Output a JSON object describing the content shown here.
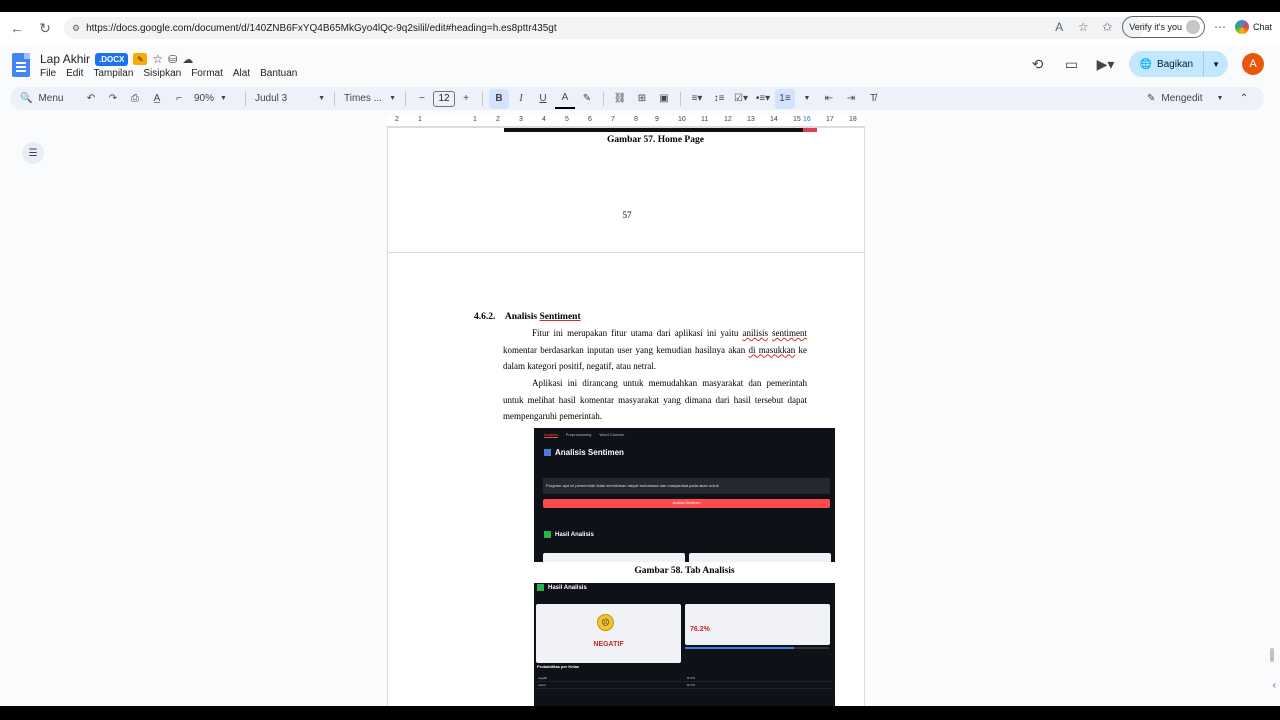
{
  "browser": {
    "url": "https://docs.google.com/document/d/140ZNB6FxYQ4B65MkGyo4lQc-9q2silil/edit#heading=h.es8pttr435gt",
    "verify_label": "Verify it's you",
    "chat_label": "Chat"
  },
  "doc": {
    "title": "Lap Akhir",
    "badge": ".DOCX",
    "menus": [
      "File",
      "Edit",
      "Tampilan",
      "Sisipkan",
      "Format",
      "Alat",
      "Bantuan"
    ],
    "share_label": "Bagikan",
    "avatar_letter": "A"
  },
  "toolbar": {
    "menu_label": "Menu",
    "zoom": "90%",
    "style": "Judul 3",
    "font": "Times ...",
    "font_size": "12",
    "mode": "Mengedit"
  },
  "ruler": {
    "ticks": [
      "2",
      "1",
      "1",
      "2",
      "3",
      "4",
      "5",
      "6",
      "7",
      "8",
      "9",
      "10",
      "11",
      "12",
      "13",
      "14",
      "15",
      "16",
      "17",
      "18"
    ]
  },
  "page1": {
    "caption": "Gambar 57. Home Page",
    "page_number": "57"
  },
  "page2": {
    "heading_num": "4.6.2.",
    "heading_text": "Analisis",
    "heading_word": "Sentiment",
    "para1_a": "Fitur ini merupakan fitur utama dari aplikasi ini yaitu",
    "para1_w1": "anilisis",
    "para1_w2": "sentiment",
    "para1_b": "komentar berdasarkan inputan user yang kemudian hasilnya akan",
    "para1_w3": "di masukkan",
    "para1_c": "ke dalam kategori positif, negatif, atau netral.",
    "para2": "Aplikasi ini dirancang untuk memudahkan masyarakat dan pemerintah untuk melihat hasil komentar masyarakat yang dimana dari hasil tersebut dapat mempengaruhi pemerintah.",
    "caption58": "Gambar 58. Tab Analisis"
  },
  "shot1": {
    "tabs": [
      "Analisis",
      "Preprocessing",
      "Word Counter"
    ],
    "title": "Analisis Sentimen",
    "input_text": "Program apa ini pemerintah tidak memikirkan rakyat berbahasa dan masyarakat pada akan untuk",
    "button": "Analisis Sentimen",
    "result_title": "Hasil Analisis"
  },
  "shot2": {
    "result_title": "Hasil Analisis",
    "label": "NEGATIF",
    "percent": "76.2%",
    "confidence_fraction": 0.76,
    "table_title": "Probabilitas per Kelas",
    "rows": [
      [
        "negatif",
        "76.2%"
      ],
      [
        "netral",
        "16.1%"
      ]
    ]
  },
  "colors": {
    "accent": "#1a73e8",
    "share_bg": "#c2e7ff",
    "streamlit_red": "#ff4b4b",
    "negative": "#c62828"
  }
}
